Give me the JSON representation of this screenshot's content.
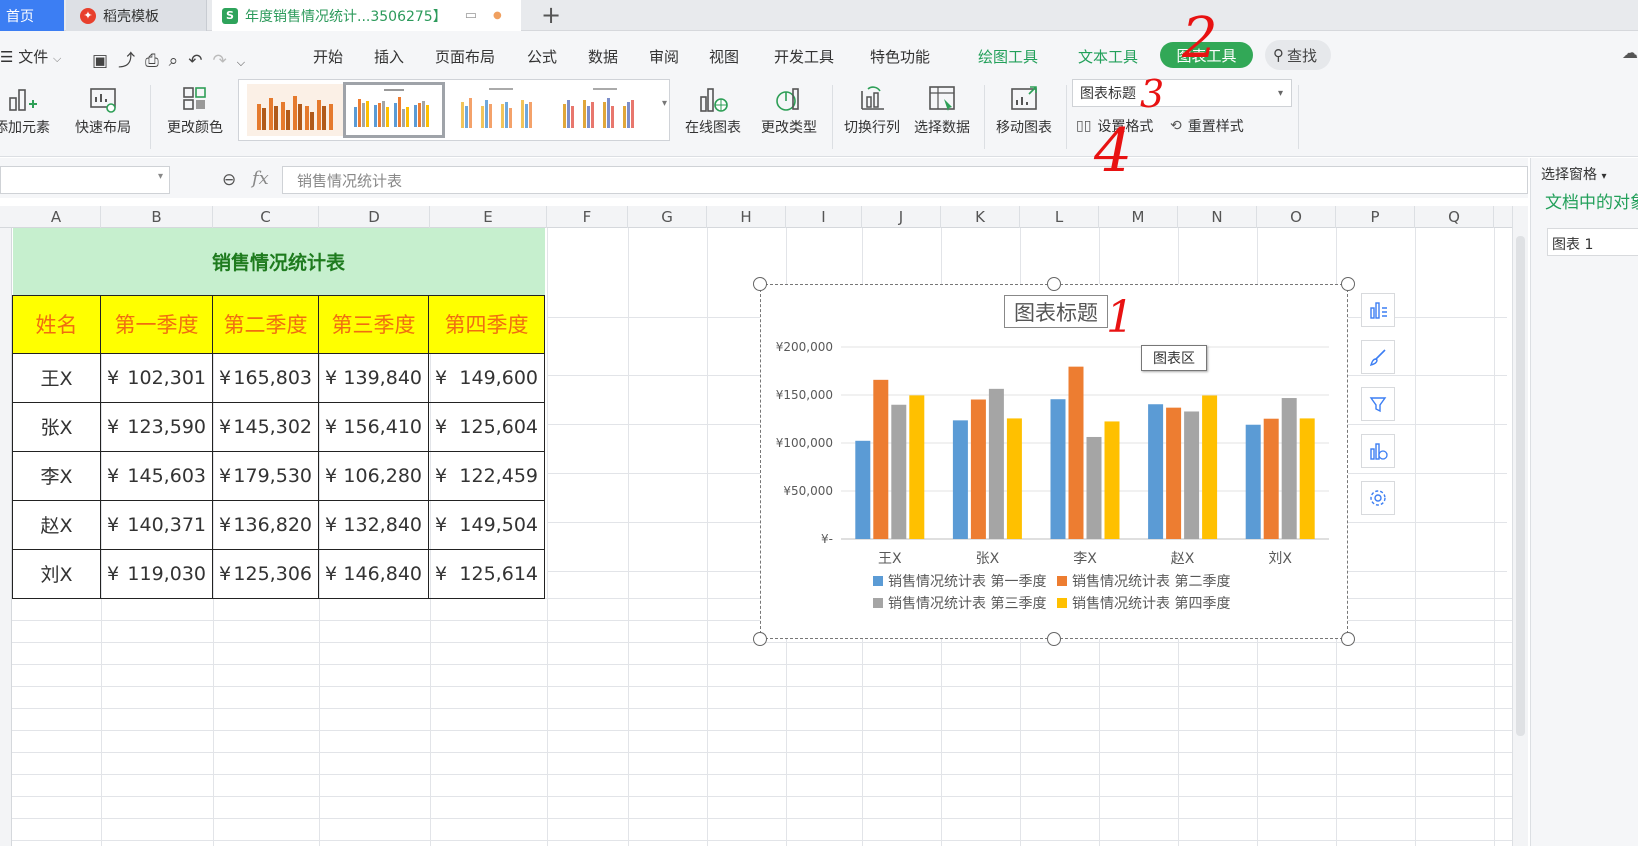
{
  "tabs": {
    "home": "首页",
    "template": "稻壳模板",
    "document": "年度销售情况统计...3506275】"
  },
  "menu": {
    "file": "文件",
    "items": [
      "开始",
      "插入",
      "页面布局",
      "公式",
      "数据",
      "审阅",
      "视图",
      "开发工具",
      "特色功能"
    ],
    "draw_tools": "绘图工具",
    "text_tools": "文本工具",
    "chart_tools": "图表工具",
    "search": "查找"
  },
  "ribbon": {
    "add_element": "添加元素",
    "quick_layout": "快速布局",
    "change_color": "更改颜色",
    "online_chart": "在线图表",
    "change_type": "更改类型",
    "switch_rowcol": "切换行列",
    "select_data": "选择数据",
    "move_chart": "移动图表",
    "element_select": "图表标题",
    "set_format": "设置格式",
    "reset_style": "重置样式"
  },
  "formula": {
    "fx": "fx",
    "content": "销售情况统计表"
  },
  "columns": [
    "A",
    "B",
    "C",
    "D",
    "E",
    "F",
    "G",
    "H",
    "I",
    "J",
    "K",
    "L",
    "M",
    "N",
    "O",
    "P",
    "Q"
  ],
  "table": {
    "title": "销售情况统计表",
    "headers": [
      "姓名",
      "第一季度",
      "第二季度",
      "第三季度",
      "第四季度"
    ],
    "currency": "¥",
    "rows": [
      {
        "name": "王X",
        "values": [
          "102,301",
          "165,803",
          "139,840",
          "149,600"
        ]
      },
      {
        "name": "张X",
        "values": [
          "123,590",
          "145,302",
          "156,410",
          "125,604"
        ]
      },
      {
        "name": "李X",
        "values": [
          "145,603",
          "179,530",
          "106,280",
          "122,459"
        ]
      },
      {
        "name": "赵X",
        "values": [
          "140,371",
          "136,820",
          "132,840",
          "149,504"
        ]
      },
      {
        "name": "刘X",
        "values": [
          "119,030",
          "125,306",
          "146,840",
          "125,614"
        ]
      }
    ]
  },
  "chart": {
    "title": "图表标题",
    "tooltip": "图表区"
  },
  "chart_data": {
    "type": "bar",
    "title": "图表标题",
    "categories": [
      "王X",
      "张X",
      "李X",
      "赵X",
      "刘X"
    ],
    "ylim": [
      0,
      200000
    ],
    "yticks": [
      "¥-",
      "¥50,000",
      "¥100,000",
      "¥150,000",
      "¥200,000"
    ],
    "grid": true,
    "legend": "bottom",
    "series": [
      {
        "name": "销售情况统计表 第一季度",
        "color": "#5b9bd5",
        "values": [
          102301,
          123590,
          145603,
          140371,
          119030
        ]
      },
      {
        "name": "销售情况统计表 第二季度",
        "color": "#ed7d31",
        "values": [
          165803,
          145302,
          179530,
          136820,
          125306
        ]
      },
      {
        "name": "销售情况统计表 第三季度",
        "color": "#a5a5a5",
        "values": [
          139840,
          156410,
          106280,
          132840,
          146840
        ]
      },
      {
        "name": "销售情况统计表 第四季度",
        "color": "#ffc000",
        "values": [
          149600,
          125604,
          122459,
          149504,
          125614
        ]
      }
    ]
  },
  "right_pane": {
    "title": "选择窗格",
    "objects_label": "文档中的对象",
    "item": "图表 1"
  },
  "annotations": [
    "1",
    "2",
    "3",
    "4"
  ]
}
